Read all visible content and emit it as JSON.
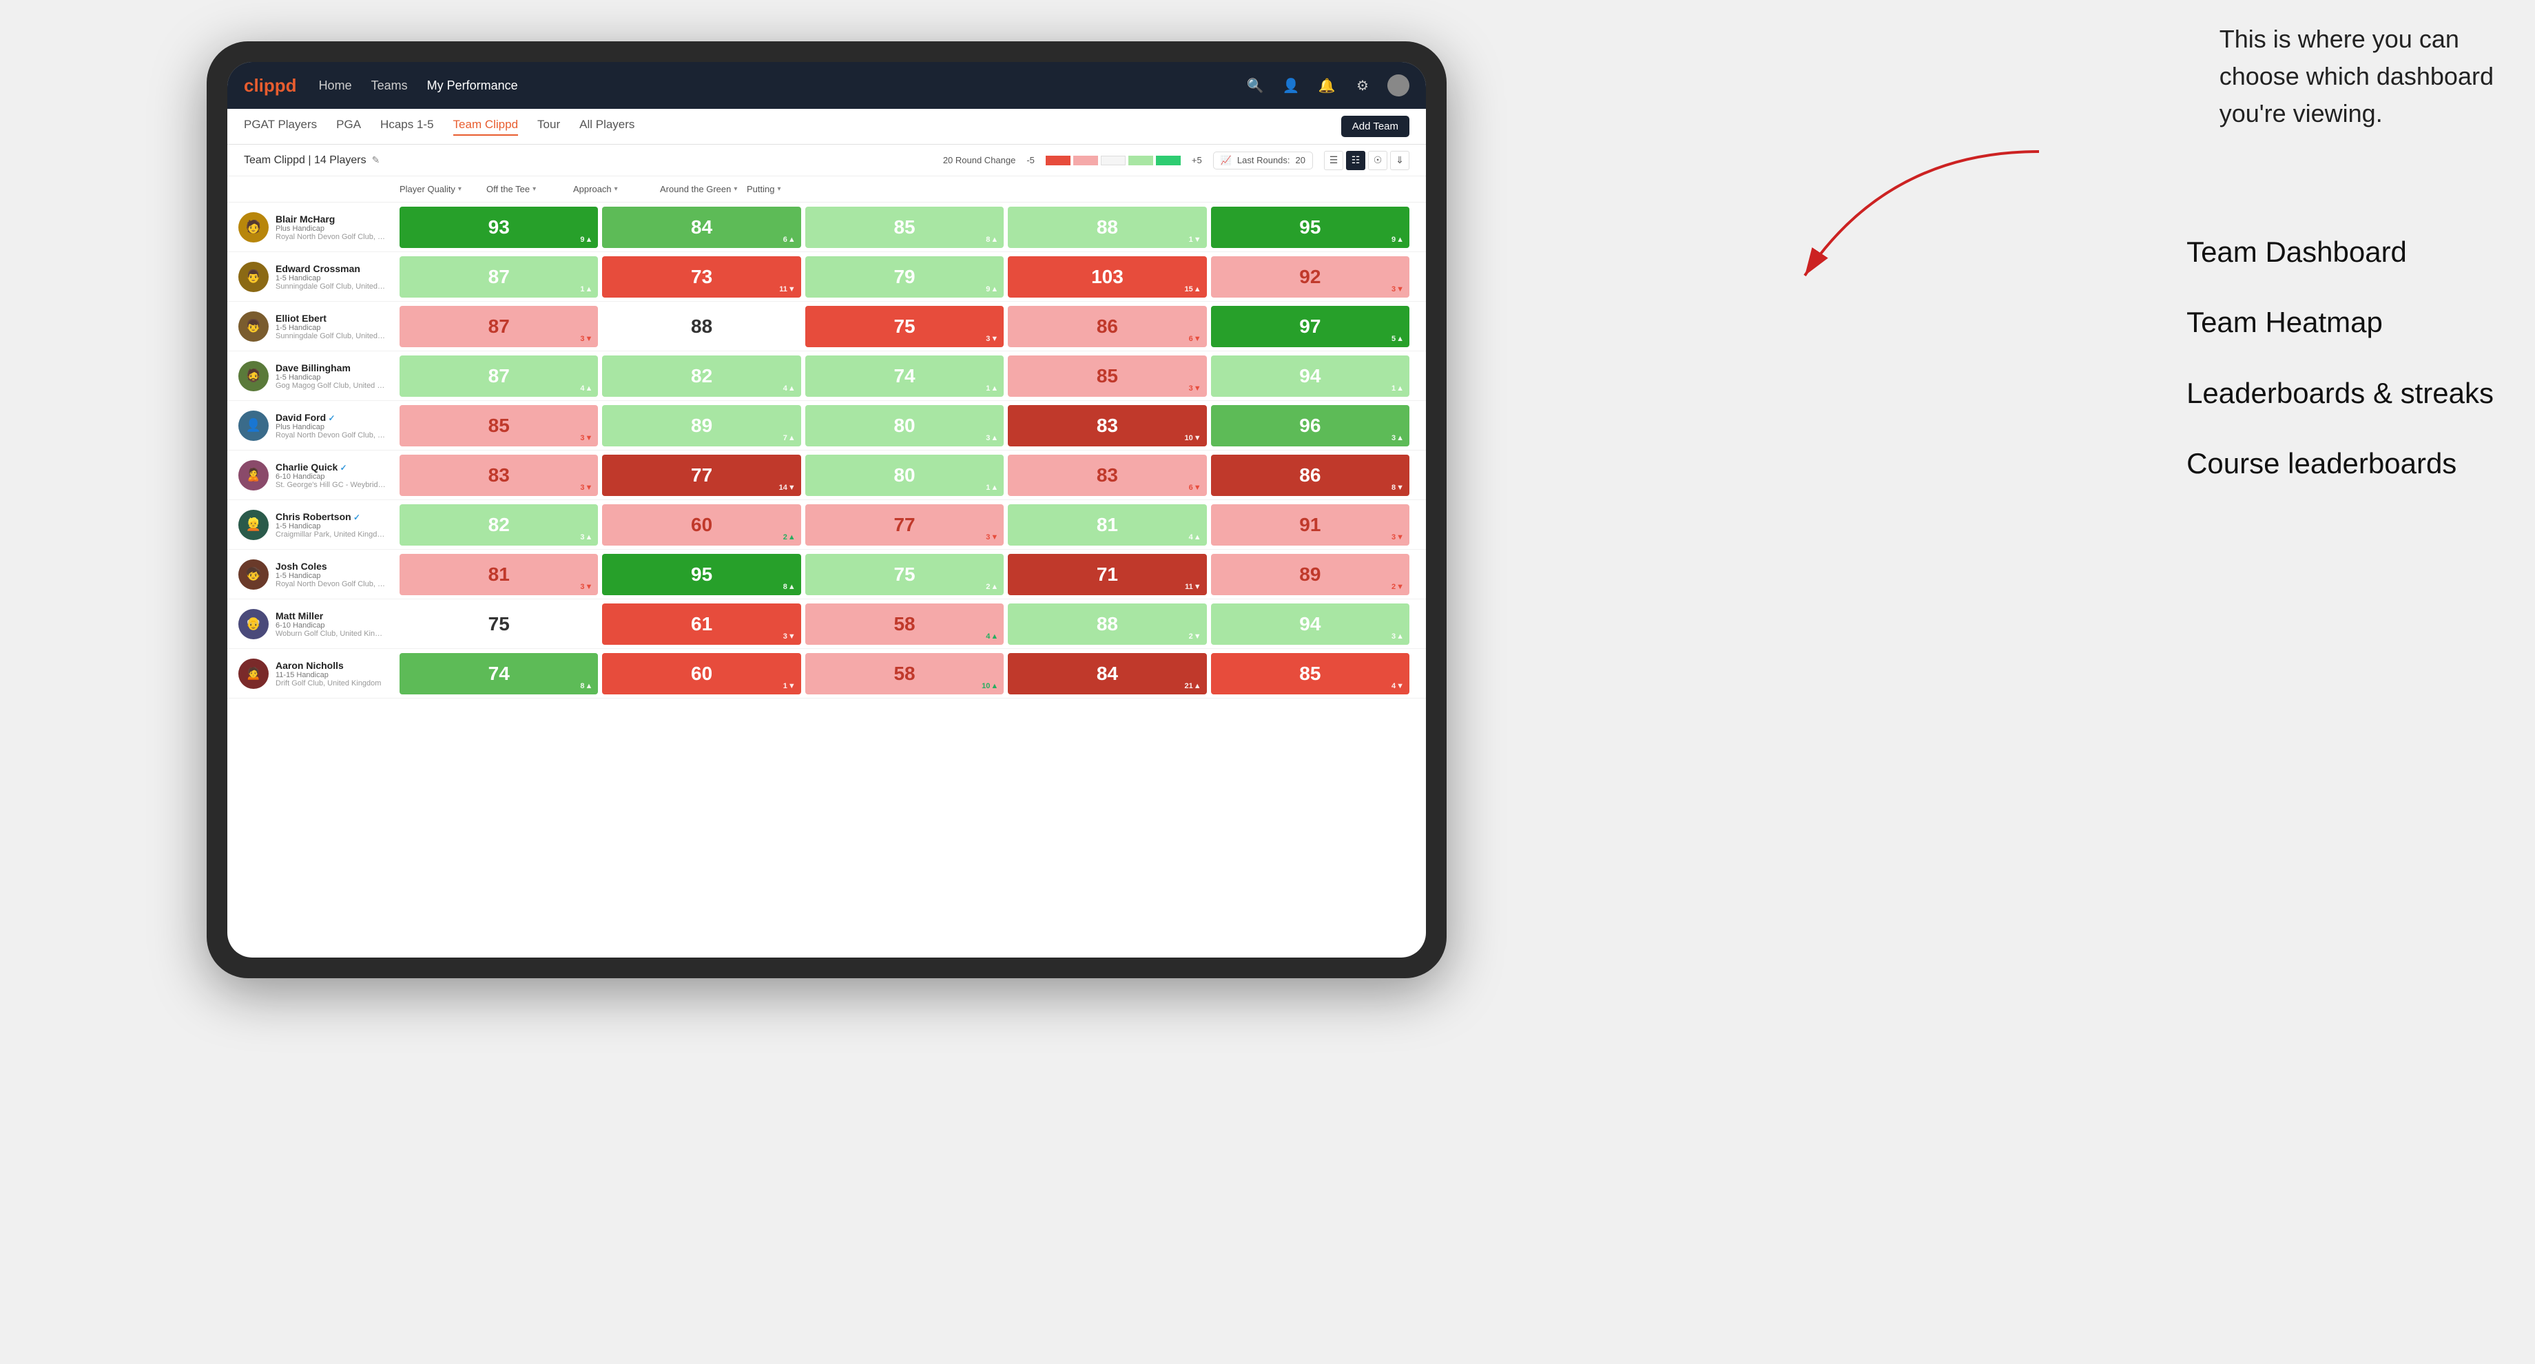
{
  "annotation": {
    "line1": "This is where you can",
    "line2": "choose which dashboard",
    "line3": "you're viewing."
  },
  "dashboard_labels": [
    "Team Dashboard",
    "Team Heatmap",
    "Leaderboards & streaks",
    "Course leaderboards"
  ],
  "nav": {
    "logo": "clippd",
    "links": [
      {
        "label": "Home",
        "active": false
      },
      {
        "label": "Teams",
        "active": false
      },
      {
        "label": "My Performance",
        "active": true
      }
    ]
  },
  "sub_nav": {
    "links": [
      {
        "label": "PGAT Players",
        "active": false
      },
      {
        "label": "PGA",
        "active": false
      },
      {
        "label": "Hcaps 1-5",
        "active": false
      },
      {
        "label": "Team Clippd",
        "active": true
      },
      {
        "label": "Tour",
        "active": false
      },
      {
        "label": "All Players",
        "active": false
      }
    ],
    "add_team_btn": "Add Team"
  },
  "team_info": {
    "name": "Team Clippd",
    "count": "14 Players",
    "round_change_label": "20 Round Change",
    "range_low": "-5",
    "range_high": "+5",
    "last_rounds_label": "Last Rounds:",
    "last_rounds_val": "20"
  },
  "col_headers": [
    {
      "label": "Player Quality",
      "arrow": "▾"
    },
    {
      "label": "Off the Tee",
      "arrow": "▾"
    },
    {
      "label": "Approach",
      "arrow": "▾"
    },
    {
      "label": "Around the Green",
      "arrow": "▾"
    },
    {
      "label": "Putting",
      "arrow": "▾"
    }
  ],
  "players": [
    {
      "name": "Blair McHarg",
      "handicap": "Plus Handicap",
      "club": "Royal North Devon Golf Club, United Kingdom",
      "avatar_color": "#b8860b",
      "scores": [
        {
          "val": "93",
          "change": "9",
          "dir": "up",
          "color": "green-dark"
        },
        {
          "val": "84",
          "change": "6",
          "dir": "up",
          "color": "green-mid"
        },
        {
          "val": "85",
          "change": "8",
          "dir": "up",
          "color": "green-light"
        },
        {
          "val": "88",
          "change": "1",
          "dir": "down",
          "color": "green-light"
        },
        {
          "val": "95",
          "change": "9",
          "dir": "up",
          "color": "green-dark"
        }
      ]
    },
    {
      "name": "Edward Crossman",
      "handicap": "1-5 Handicap",
      "club": "Sunningdale Golf Club, United Kingdom",
      "avatar_color": "#8b6914",
      "scores": [
        {
          "val": "87",
          "change": "1",
          "dir": "up",
          "color": "green-light"
        },
        {
          "val": "73",
          "change": "11",
          "dir": "down",
          "color": "red-mid"
        },
        {
          "val": "79",
          "change": "9",
          "dir": "up",
          "color": "green-light"
        },
        {
          "val": "103",
          "change": "15",
          "dir": "up",
          "color": "red-mid"
        },
        {
          "val": "92",
          "change": "3",
          "dir": "down",
          "color": "red-light"
        }
      ]
    },
    {
      "name": "Elliot Ebert",
      "handicap": "1-5 Handicap",
      "club": "Sunningdale Golf Club, United Kingdom",
      "avatar_color": "#7a5c2e",
      "scores": [
        {
          "val": "87",
          "change": "3",
          "dir": "down",
          "color": "red-light"
        },
        {
          "val": "88",
          "change": "",
          "dir": "",
          "color": "white"
        },
        {
          "val": "75",
          "change": "3",
          "dir": "down",
          "color": "red-mid"
        },
        {
          "val": "86",
          "change": "6",
          "dir": "down",
          "color": "red-light"
        },
        {
          "val": "97",
          "change": "5",
          "dir": "up",
          "color": "green-dark"
        }
      ]
    },
    {
      "name": "Dave Billingham",
      "handicap": "1-5 Handicap",
      "club": "Gog Magog Golf Club, United Kingdom",
      "avatar_color": "#5a7a3a",
      "scores": [
        {
          "val": "87",
          "change": "4",
          "dir": "up",
          "color": "green-light"
        },
        {
          "val": "82",
          "change": "4",
          "dir": "up",
          "color": "green-light"
        },
        {
          "val": "74",
          "change": "1",
          "dir": "up",
          "color": "green-light"
        },
        {
          "val": "85",
          "change": "3",
          "dir": "down",
          "color": "red-light"
        },
        {
          "val": "94",
          "change": "1",
          "dir": "up",
          "color": "green-light"
        }
      ]
    },
    {
      "name": "David Ford",
      "verified": true,
      "handicap": "Plus Handicap",
      "club": "Royal North Devon Golf Club, United Kingdom",
      "avatar_color": "#3a6b8a",
      "scores": [
        {
          "val": "85",
          "change": "3",
          "dir": "down",
          "color": "red-light"
        },
        {
          "val": "89",
          "change": "7",
          "dir": "up",
          "color": "green-light"
        },
        {
          "val": "80",
          "change": "3",
          "dir": "up",
          "color": "green-light"
        },
        {
          "val": "83",
          "change": "10",
          "dir": "down",
          "color": "red-dark"
        },
        {
          "val": "96",
          "change": "3",
          "dir": "up",
          "color": "green-mid"
        }
      ]
    },
    {
      "name": "Charlie Quick",
      "verified": true,
      "handicap": "6-10 Handicap",
      "club": "St. George's Hill GC - Weybridge - Surrey, Uni...",
      "avatar_color": "#8a4a6a",
      "scores": [
        {
          "val": "83",
          "change": "3",
          "dir": "down",
          "color": "red-light"
        },
        {
          "val": "77",
          "change": "14",
          "dir": "down",
          "color": "red-dark"
        },
        {
          "val": "80",
          "change": "1",
          "dir": "up",
          "color": "green-light"
        },
        {
          "val": "83",
          "change": "6",
          "dir": "down",
          "color": "red-light"
        },
        {
          "val": "86",
          "change": "8",
          "dir": "down",
          "color": "red-dark"
        }
      ]
    },
    {
      "name": "Chris Robertson",
      "verified": true,
      "handicap": "1-5 Handicap",
      "club": "Craigmillar Park, United Kingdom",
      "avatar_color": "#2a5a4a",
      "scores": [
        {
          "val": "82",
          "change": "3",
          "dir": "up",
          "color": "green-light"
        },
        {
          "val": "60",
          "change": "2",
          "dir": "up",
          "color": "red-light"
        },
        {
          "val": "77",
          "change": "3",
          "dir": "down",
          "color": "red-light"
        },
        {
          "val": "81",
          "change": "4",
          "dir": "up",
          "color": "green-light"
        },
        {
          "val": "91",
          "change": "3",
          "dir": "down",
          "color": "red-light"
        }
      ]
    },
    {
      "name": "Josh Coles",
      "handicap": "1-5 Handicap",
      "club": "Royal North Devon Golf Club, United Kingdom",
      "avatar_color": "#6a3a2a",
      "scores": [
        {
          "val": "81",
          "change": "3",
          "dir": "down",
          "color": "red-light"
        },
        {
          "val": "95",
          "change": "8",
          "dir": "up",
          "color": "green-dark"
        },
        {
          "val": "75",
          "change": "2",
          "dir": "up",
          "color": "green-light"
        },
        {
          "val": "71",
          "change": "11",
          "dir": "down",
          "color": "red-dark"
        },
        {
          "val": "89",
          "change": "2",
          "dir": "down",
          "color": "red-light"
        }
      ]
    },
    {
      "name": "Matt Miller",
      "handicap": "6-10 Handicap",
      "club": "Woburn Golf Club, United Kingdom",
      "avatar_color": "#4a4a7a",
      "scores": [
        {
          "val": "75",
          "change": "",
          "dir": "",
          "color": "white"
        },
        {
          "val": "61",
          "change": "3",
          "dir": "down",
          "color": "red-mid"
        },
        {
          "val": "58",
          "change": "4",
          "dir": "up",
          "color": "red-light"
        },
        {
          "val": "88",
          "change": "2",
          "dir": "down",
          "color": "green-light"
        },
        {
          "val": "94",
          "change": "3",
          "dir": "up",
          "color": "green-light"
        }
      ]
    },
    {
      "name": "Aaron Nicholls",
      "handicap": "11-15 Handicap",
      "club": "Drift Golf Club, United Kingdom",
      "avatar_color": "#7a2a2a",
      "scores": [
        {
          "val": "74",
          "change": "8",
          "dir": "up",
          "color": "green-mid"
        },
        {
          "val": "60",
          "change": "1",
          "dir": "down",
          "color": "red-mid"
        },
        {
          "val": "58",
          "change": "10",
          "dir": "up",
          "color": "red-light"
        },
        {
          "val": "84",
          "change": "21",
          "dir": "up",
          "color": "red-dark"
        },
        {
          "val": "85",
          "change": "4",
          "dir": "down",
          "color": "red-mid"
        }
      ]
    }
  ]
}
